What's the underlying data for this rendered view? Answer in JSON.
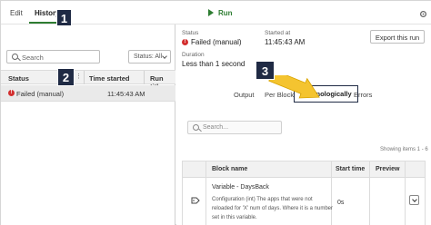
{
  "topbar": {
    "tabs": [
      {
        "label": "Edit"
      },
      {
        "label": "History"
      }
    ],
    "run_label": "Run",
    "accent_color": "#2e7d32"
  },
  "callouts": [
    {
      "number": "1"
    },
    {
      "number": "2"
    },
    {
      "number": "3"
    }
  ],
  "history_panel": {
    "search_placeholder": "Search",
    "status_filter": "Status: All",
    "columns": [
      "Status",
      "Time started",
      "Run title"
    ],
    "rows": [
      {
        "status": "Failed (manual)",
        "time_started": "11:45:43 AM",
        "run_title": ""
      }
    ]
  },
  "details": {
    "status_label": "Status",
    "status_value": "Failed (manual)",
    "started_label": "Started at",
    "started_value": "11:45:43 AM",
    "duration_label": "Duration",
    "duration_value": "Less than 1 second",
    "export_label": "Export this run",
    "subtabs": [
      {
        "label": "Output"
      },
      {
        "label": "Per Block"
      },
      {
        "label": "Chronologically"
      },
      {
        "label": "Errors"
      }
    ],
    "search_placeholder": "Search...",
    "showing": "Showing items 1 - 6",
    "table": {
      "columns": [
        "Block name",
        "Start time",
        "Preview"
      ],
      "rows": [
        {
          "block_title": "Variable - DaysBack",
          "block_description": "Configuration (int) The apps that were not reloaded for 'X' num of days. Where it is a number set in this variable.",
          "start_time": "0s",
          "icon": "tag-icon"
        }
      ]
    }
  }
}
